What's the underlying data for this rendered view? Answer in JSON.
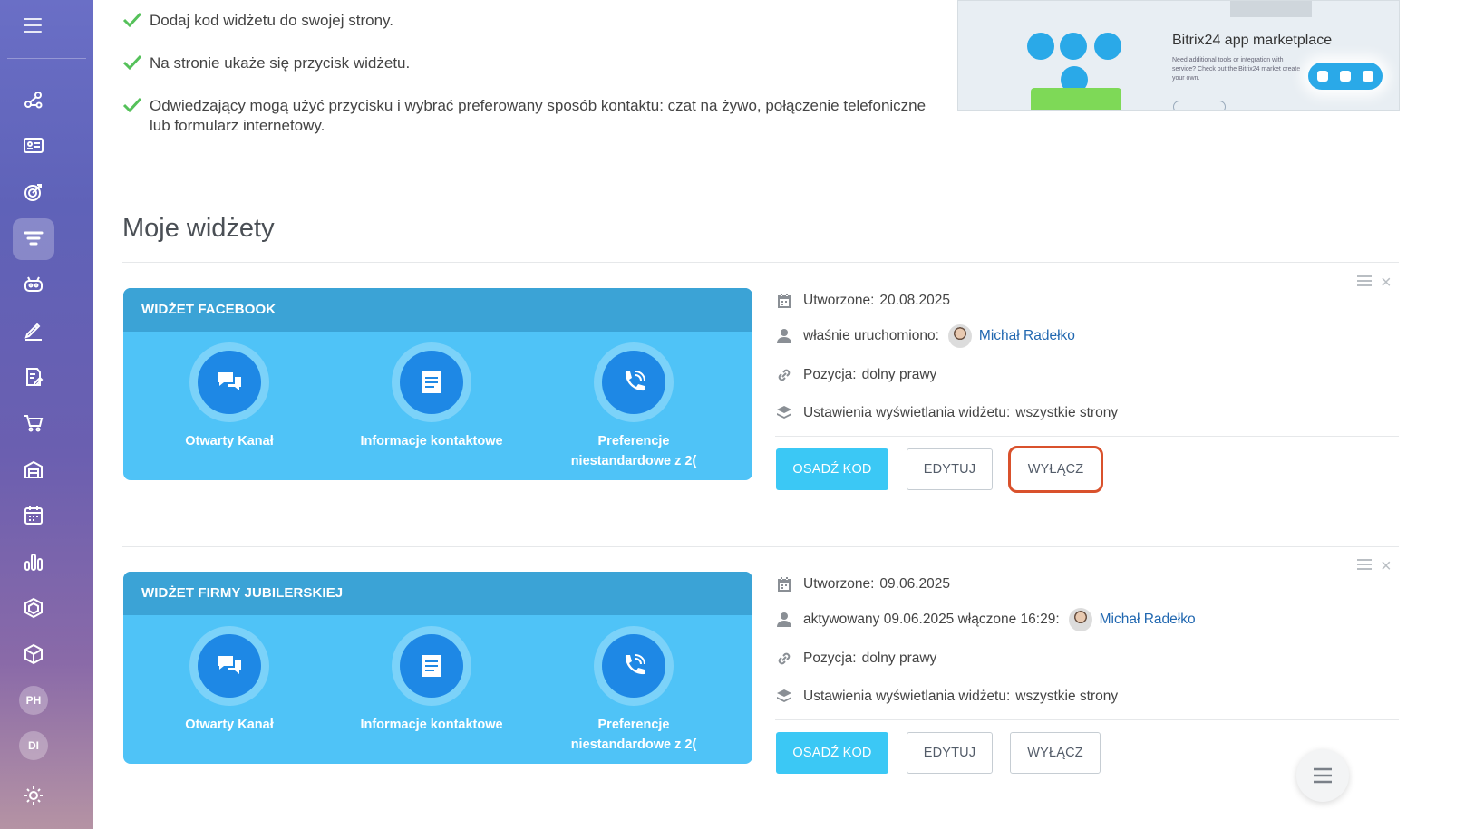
{
  "sidebar": {
    "icons": [
      "connections-icon",
      "crm-card-icon",
      "target-icon",
      "funnel-icon",
      "robot-icon",
      "pen-icon",
      "document-sign-icon",
      "cart-icon",
      "store-icon",
      "calendar-grid-icon",
      "bar-chart-icon",
      "hexagon-icon",
      "box-icon",
      "settings-icon"
    ],
    "avatars": [
      "PH",
      "DI"
    ]
  },
  "steps": [
    "Dodaj kod widżetu do swojej strony.",
    "Na stronie ukaże się przycisk widżetu.",
    "Odwiedzający mogą użyć przycisku i wybrać preferowany sposób kontaktu: czat na żywo, połączenie telefoniczne lub formularz internetowy."
  ],
  "banner": {
    "title": "Bitrix24 app marketplace",
    "subtitle": "Need additional tools or integration with service? Check out the Bitrix24 market create your own."
  },
  "section_title": "Moje widżety",
  "widgets": [
    {
      "name": "WIDŻET FACEBOOK",
      "items": [
        "Otwarty Kanał",
        "Informacje kontaktowe",
        "Preferencje niestandardowe z 2("
      ],
      "created_label": "Utworzone:",
      "created_value": "20.08.2025",
      "status_label": "właśnie uruchomiono:",
      "user": "Michał Radełko",
      "position_label": "Pozycja:",
      "position_value": "dolny prawy",
      "display_label": "Ustawienia wyświetlania widżetu:",
      "display_value": "wszystkie strony",
      "buttons": {
        "embed": "OSADŹ KOD",
        "edit": "EDYTUJ",
        "disable": "WYŁĄCZ"
      }
    },
    {
      "name": "WIDŻET FIRMY JUBILERSKIEJ",
      "items": [
        "Otwarty Kanał",
        "Informacje kontaktowe",
        "Preferencje niestandardowe z 2("
      ],
      "created_label": "Utworzone:",
      "created_value": "09.06.2025",
      "status_label": "aktywowany 09.06.2025 włączone 16:29:",
      "user": "Michał Radełko",
      "position_label": "Pozycja:",
      "position_value": "dolny prawy",
      "display_label": "Ustawienia wyświetlania widżetu:",
      "display_value": "wszystkie strony",
      "buttons": {
        "embed": "OSADŹ KOD",
        "edit": "EDYTUJ",
        "disable": "WYŁĄCZ"
      }
    }
  ],
  "colors": {
    "accent": "#3bc8f5",
    "widget_bg": "#4fc3f7",
    "widget_header": "#3ba3d6",
    "highlight": "#d9512c",
    "check": "#55c15a",
    "link": "#2067b0"
  }
}
